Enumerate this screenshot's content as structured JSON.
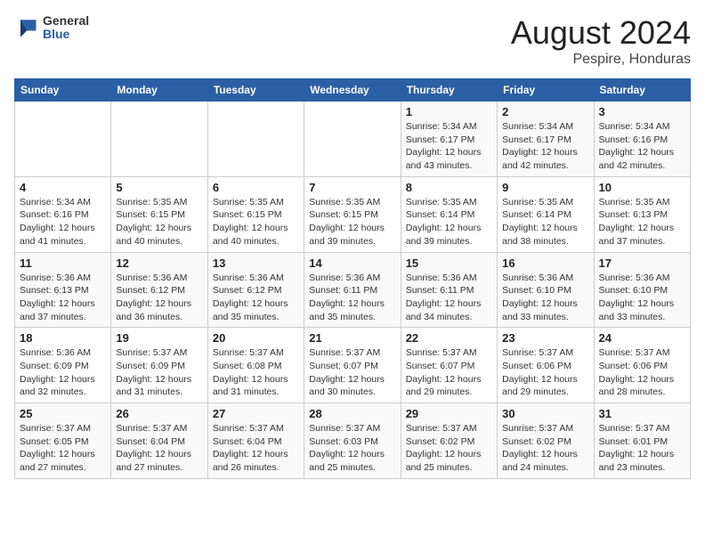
{
  "header": {
    "logo_general": "General",
    "logo_blue": "Blue",
    "month_year": "August 2024",
    "location": "Pespire, Honduras"
  },
  "calendar": {
    "days_of_week": [
      "Sunday",
      "Monday",
      "Tuesday",
      "Wednesday",
      "Thursday",
      "Friday",
      "Saturday"
    ],
    "weeks": [
      [
        {
          "day": "",
          "info": ""
        },
        {
          "day": "",
          "info": ""
        },
        {
          "day": "",
          "info": ""
        },
        {
          "day": "",
          "info": ""
        },
        {
          "day": "1",
          "info": "Sunrise: 5:34 AM\nSunset: 6:17 PM\nDaylight: 12 hours\nand 43 minutes."
        },
        {
          "day": "2",
          "info": "Sunrise: 5:34 AM\nSunset: 6:17 PM\nDaylight: 12 hours\nand 42 minutes."
        },
        {
          "day": "3",
          "info": "Sunrise: 5:34 AM\nSunset: 6:16 PM\nDaylight: 12 hours\nand 42 minutes."
        }
      ],
      [
        {
          "day": "4",
          "info": "Sunrise: 5:34 AM\nSunset: 6:16 PM\nDaylight: 12 hours\nand 41 minutes."
        },
        {
          "day": "5",
          "info": "Sunrise: 5:35 AM\nSunset: 6:15 PM\nDaylight: 12 hours\nand 40 minutes."
        },
        {
          "day": "6",
          "info": "Sunrise: 5:35 AM\nSunset: 6:15 PM\nDaylight: 12 hours\nand 40 minutes."
        },
        {
          "day": "7",
          "info": "Sunrise: 5:35 AM\nSunset: 6:15 PM\nDaylight: 12 hours\nand 39 minutes."
        },
        {
          "day": "8",
          "info": "Sunrise: 5:35 AM\nSunset: 6:14 PM\nDaylight: 12 hours\nand 39 minutes."
        },
        {
          "day": "9",
          "info": "Sunrise: 5:35 AM\nSunset: 6:14 PM\nDaylight: 12 hours\nand 38 minutes."
        },
        {
          "day": "10",
          "info": "Sunrise: 5:35 AM\nSunset: 6:13 PM\nDaylight: 12 hours\nand 37 minutes."
        }
      ],
      [
        {
          "day": "11",
          "info": "Sunrise: 5:36 AM\nSunset: 6:13 PM\nDaylight: 12 hours\nand 37 minutes."
        },
        {
          "day": "12",
          "info": "Sunrise: 5:36 AM\nSunset: 6:12 PM\nDaylight: 12 hours\nand 36 minutes."
        },
        {
          "day": "13",
          "info": "Sunrise: 5:36 AM\nSunset: 6:12 PM\nDaylight: 12 hours\nand 35 minutes."
        },
        {
          "day": "14",
          "info": "Sunrise: 5:36 AM\nSunset: 6:11 PM\nDaylight: 12 hours\nand 35 minutes."
        },
        {
          "day": "15",
          "info": "Sunrise: 5:36 AM\nSunset: 6:11 PM\nDaylight: 12 hours\nand 34 minutes."
        },
        {
          "day": "16",
          "info": "Sunrise: 5:36 AM\nSunset: 6:10 PM\nDaylight: 12 hours\nand 33 minutes."
        },
        {
          "day": "17",
          "info": "Sunrise: 5:36 AM\nSunset: 6:10 PM\nDaylight: 12 hours\nand 33 minutes."
        }
      ],
      [
        {
          "day": "18",
          "info": "Sunrise: 5:36 AM\nSunset: 6:09 PM\nDaylight: 12 hours\nand 32 minutes."
        },
        {
          "day": "19",
          "info": "Sunrise: 5:37 AM\nSunset: 6:09 PM\nDaylight: 12 hours\nand 31 minutes."
        },
        {
          "day": "20",
          "info": "Sunrise: 5:37 AM\nSunset: 6:08 PM\nDaylight: 12 hours\nand 31 minutes."
        },
        {
          "day": "21",
          "info": "Sunrise: 5:37 AM\nSunset: 6:07 PM\nDaylight: 12 hours\nand 30 minutes."
        },
        {
          "day": "22",
          "info": "Sunrise: 5:37 AM\nSunset: 6:07 PM\nDaylight: 12 hours\nand 29 minutes."
        },
        {
          "day": "23",
          "info": "Sunrise: 5:37 AM\nSunset: 6:06 PM\nDaylight: 12 hours\nand 29 minutes."
        },
        {
          "day": "24",
          "info": "Sunrise: 5:37 AM\nSunset: 6:06 PM\nDaylight: 12 hours\nand 28 minutes."
        }
      ],
      [
        {
          "day": "25",
          "info": "Sunrise: 5:37 AM\nSunset: 6:05 PM\nDaylight: 12 hours\nand 27 minutes."
        },
        {
          "day": "26",
          "info": "Sunrise: 5:37 AM\nSunset: 6:04 PM\nDaylight: 12 hours\nand 27 minutes."
        },
        {
          "day": "27",
          "info": "Sunrise: 5:37 AM\nSunset: 6:04 PM\nDaylight: 12 hours\nand 26 minutes."
        },
        {
          "day": "28",
          "info": "Sunrise: 5:37 AM\nSunset: 6:03 PM\nDaylight: 12 hours\nand 25 minutes."
        },
        {
          "day": "29",
          "info": "Sunrise: 5:37 AM\nSunset: 6:02 PM\nDaylight: 12 hours\nand 25 minutes."
        },
        {
          "day": "30",
          "info": "Sunrise: 5:37 AM\nSunset: 6:02 PM\nDaylight: 12 hours\nand 24 minutes."
        },
        {
          "day": "31",
          "info": "Sunrise: 5:37 AM\nSunset: 6:01 PM\nDaylight: 12 hours\nand 23 minutes."
        }
      ]
    ]
  }
}
